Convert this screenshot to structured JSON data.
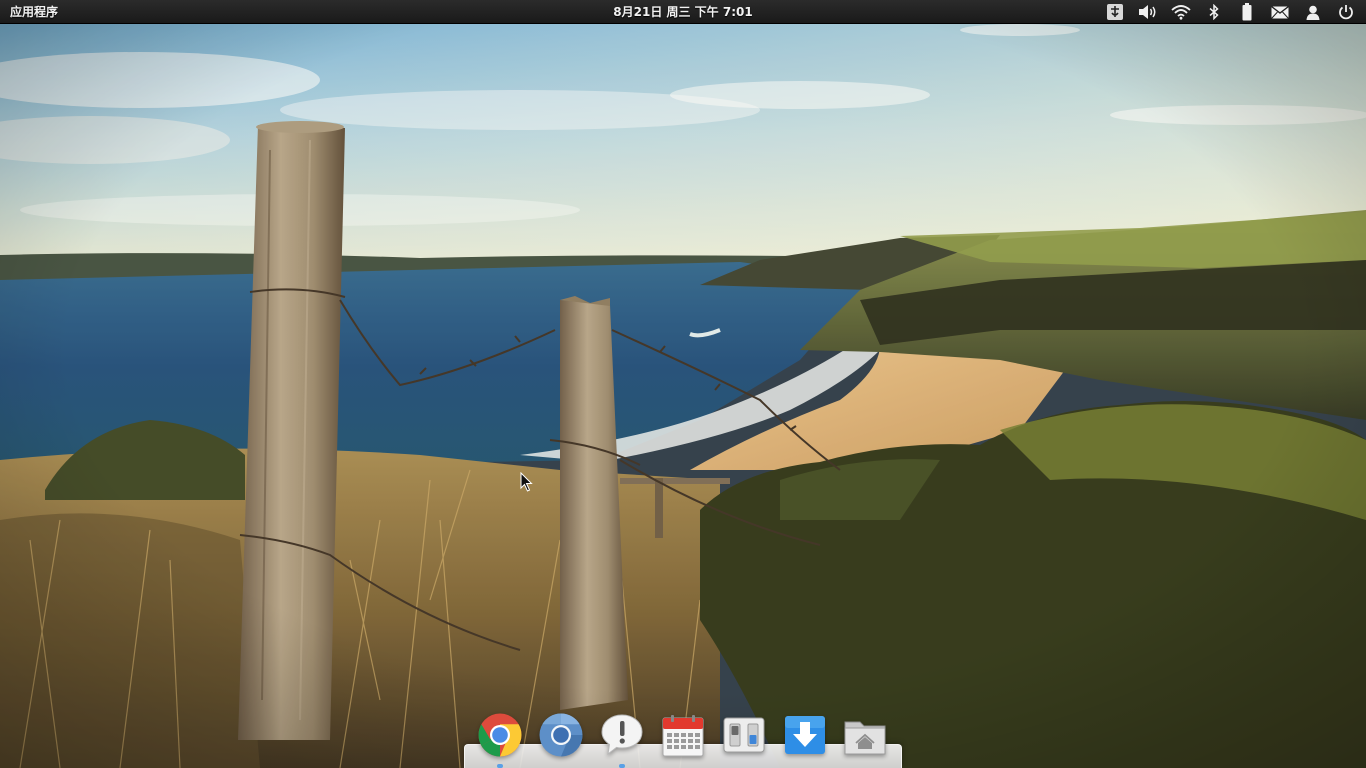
{
  "top_panel": {
    "apps_label": "应用程序",
    "clock_text": "8月21日 周三 下午 7:01",
    "indicators": [
      {
        "name": "keyboard-layout-icon"
      },
      {
        "name": "volume-icon"
      },
      {
        "name": "wifi-icon"
      },
      {
        "name": "bluetooth-icon"
      },
      {
        "name": "battery-icon"
      },
      {
        "name": "mail-icon"
      },
      {
        "name": "user-icon"
      },
      {
        "name": "power-icon"
      }
    ]
  },
  "dock": {
    "items": [
      {
        "name": "google-chrome",
        "icon": "chrome-icon",
        "running": true
      },
      {
        "name": "chromium",
        "icon": "chromium-icon",
        "running": false
      },
      {
        "name": "notifications",
        "icon": "notification-bubble-icon",
        "running": true
      },
      {
        "name": "calendar",
        "icon": "calendar-icon",
        "running": false
      },
      {
        "name": "system-settings",
        "icon": "switchboard-icon",
        "running": false
      },
      {
        "name": "downloads",
        "icon": "download-arrow-icon",
        "running": false
      },
      {
        "name": "files",
        "icon": "home-folder-icon",
        "running": false
      }
    ]
  },
  "colors": {
    "panel_bg": "#1e1e1e",
    "dock_bg": "#e8e8e8",
    "running_dot": "#5aa0e6",
    "sky_top": "#6aaed6",
    "sea": "#1c4a78",
    "sand": "#d8b07a"
  }
}
